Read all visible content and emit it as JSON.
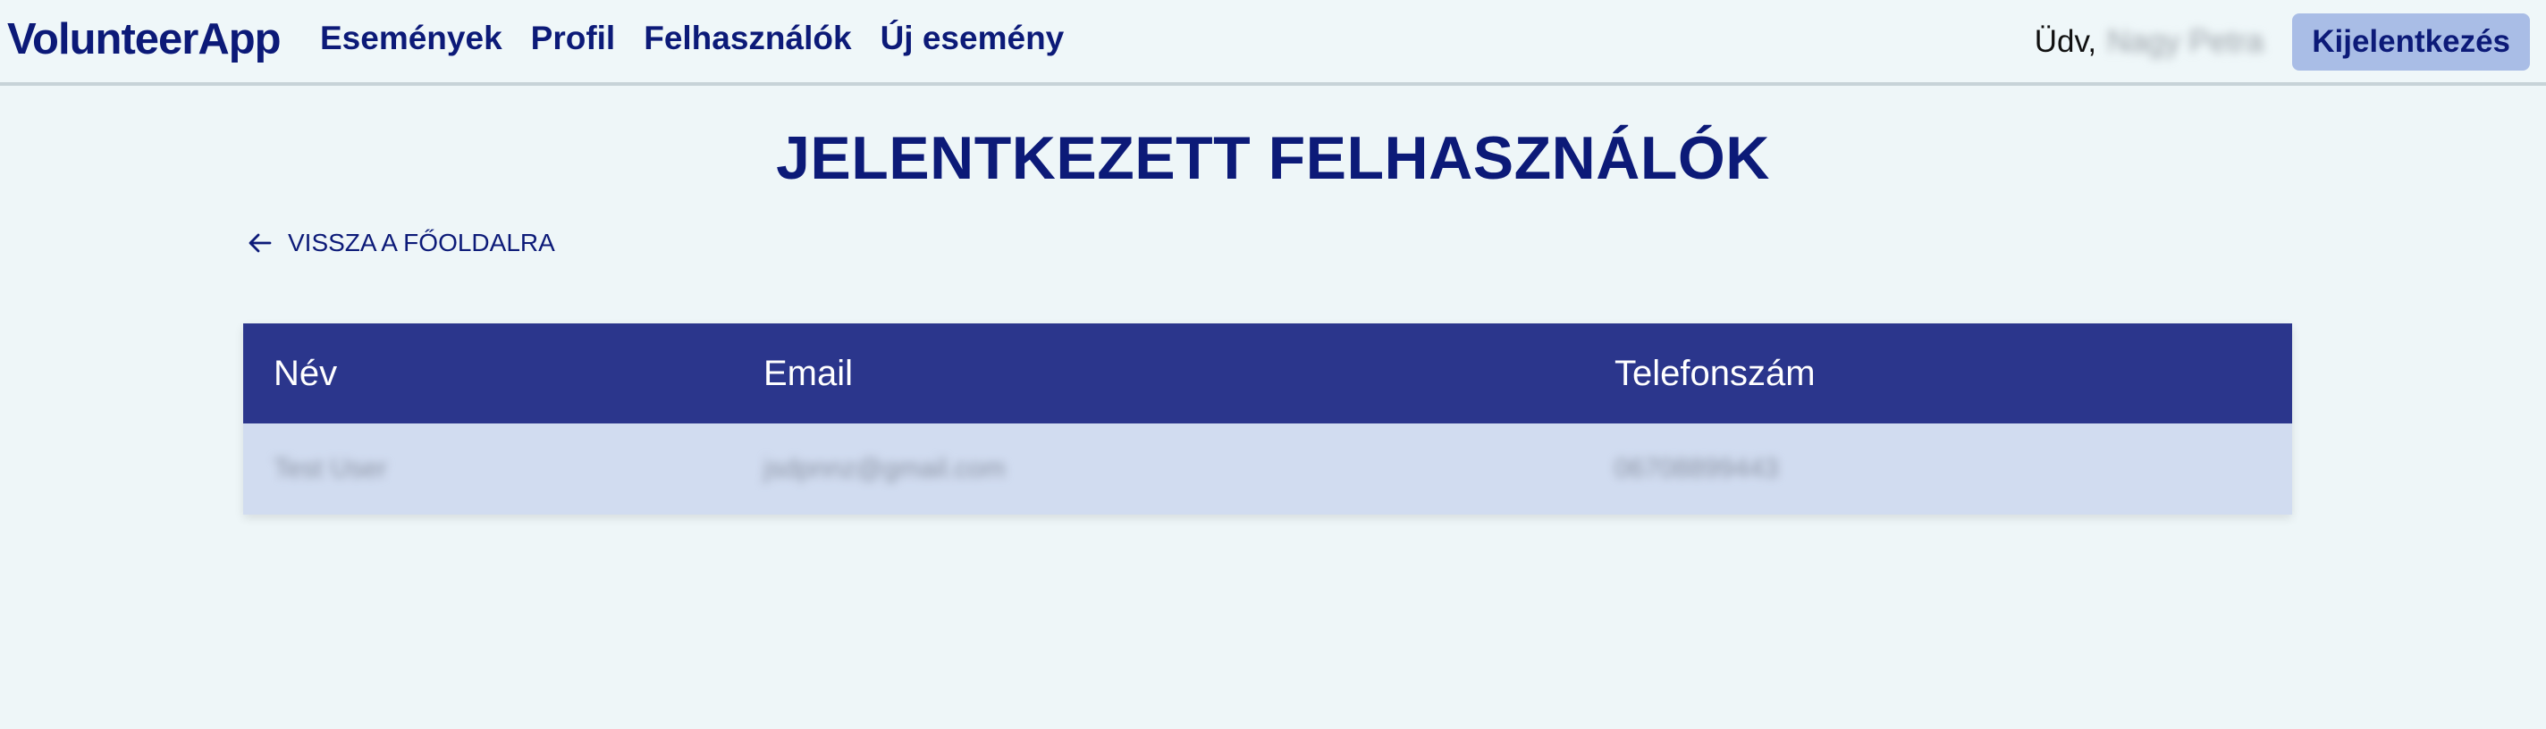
{
  "navbar": {
    "brand": "VolunteerApp",
    "links": [
      "Események",
      "Profil",
      "Felhasználók",
      "Új esemény"
    ],
    "greeting": "Üdv,",
    "username": "Nagy Petra",
    "logout_label": "Kijelentkezés"
  },
  "page": {
    "title": "JELENTKEZETT FELHASZNÁLÓK",
    "back_label": "VISSZA A FŐOLDALRA"
  },
  "table": {
    "headers": [
      "Név",
      "Email",
      "Telefonszám"
    ],
    "rows": [
      [
        "Test User",
        "jsdpnnz@gmail.com",
        "06708899443"
      ]
    ]
  },
  "colors": {
    "accent": "#0c1a78",
    "header_bg": "#2b368c",
    "row_bg": "#d1dcf0",
    "button_bg": "#a9bde6"
  }
}
